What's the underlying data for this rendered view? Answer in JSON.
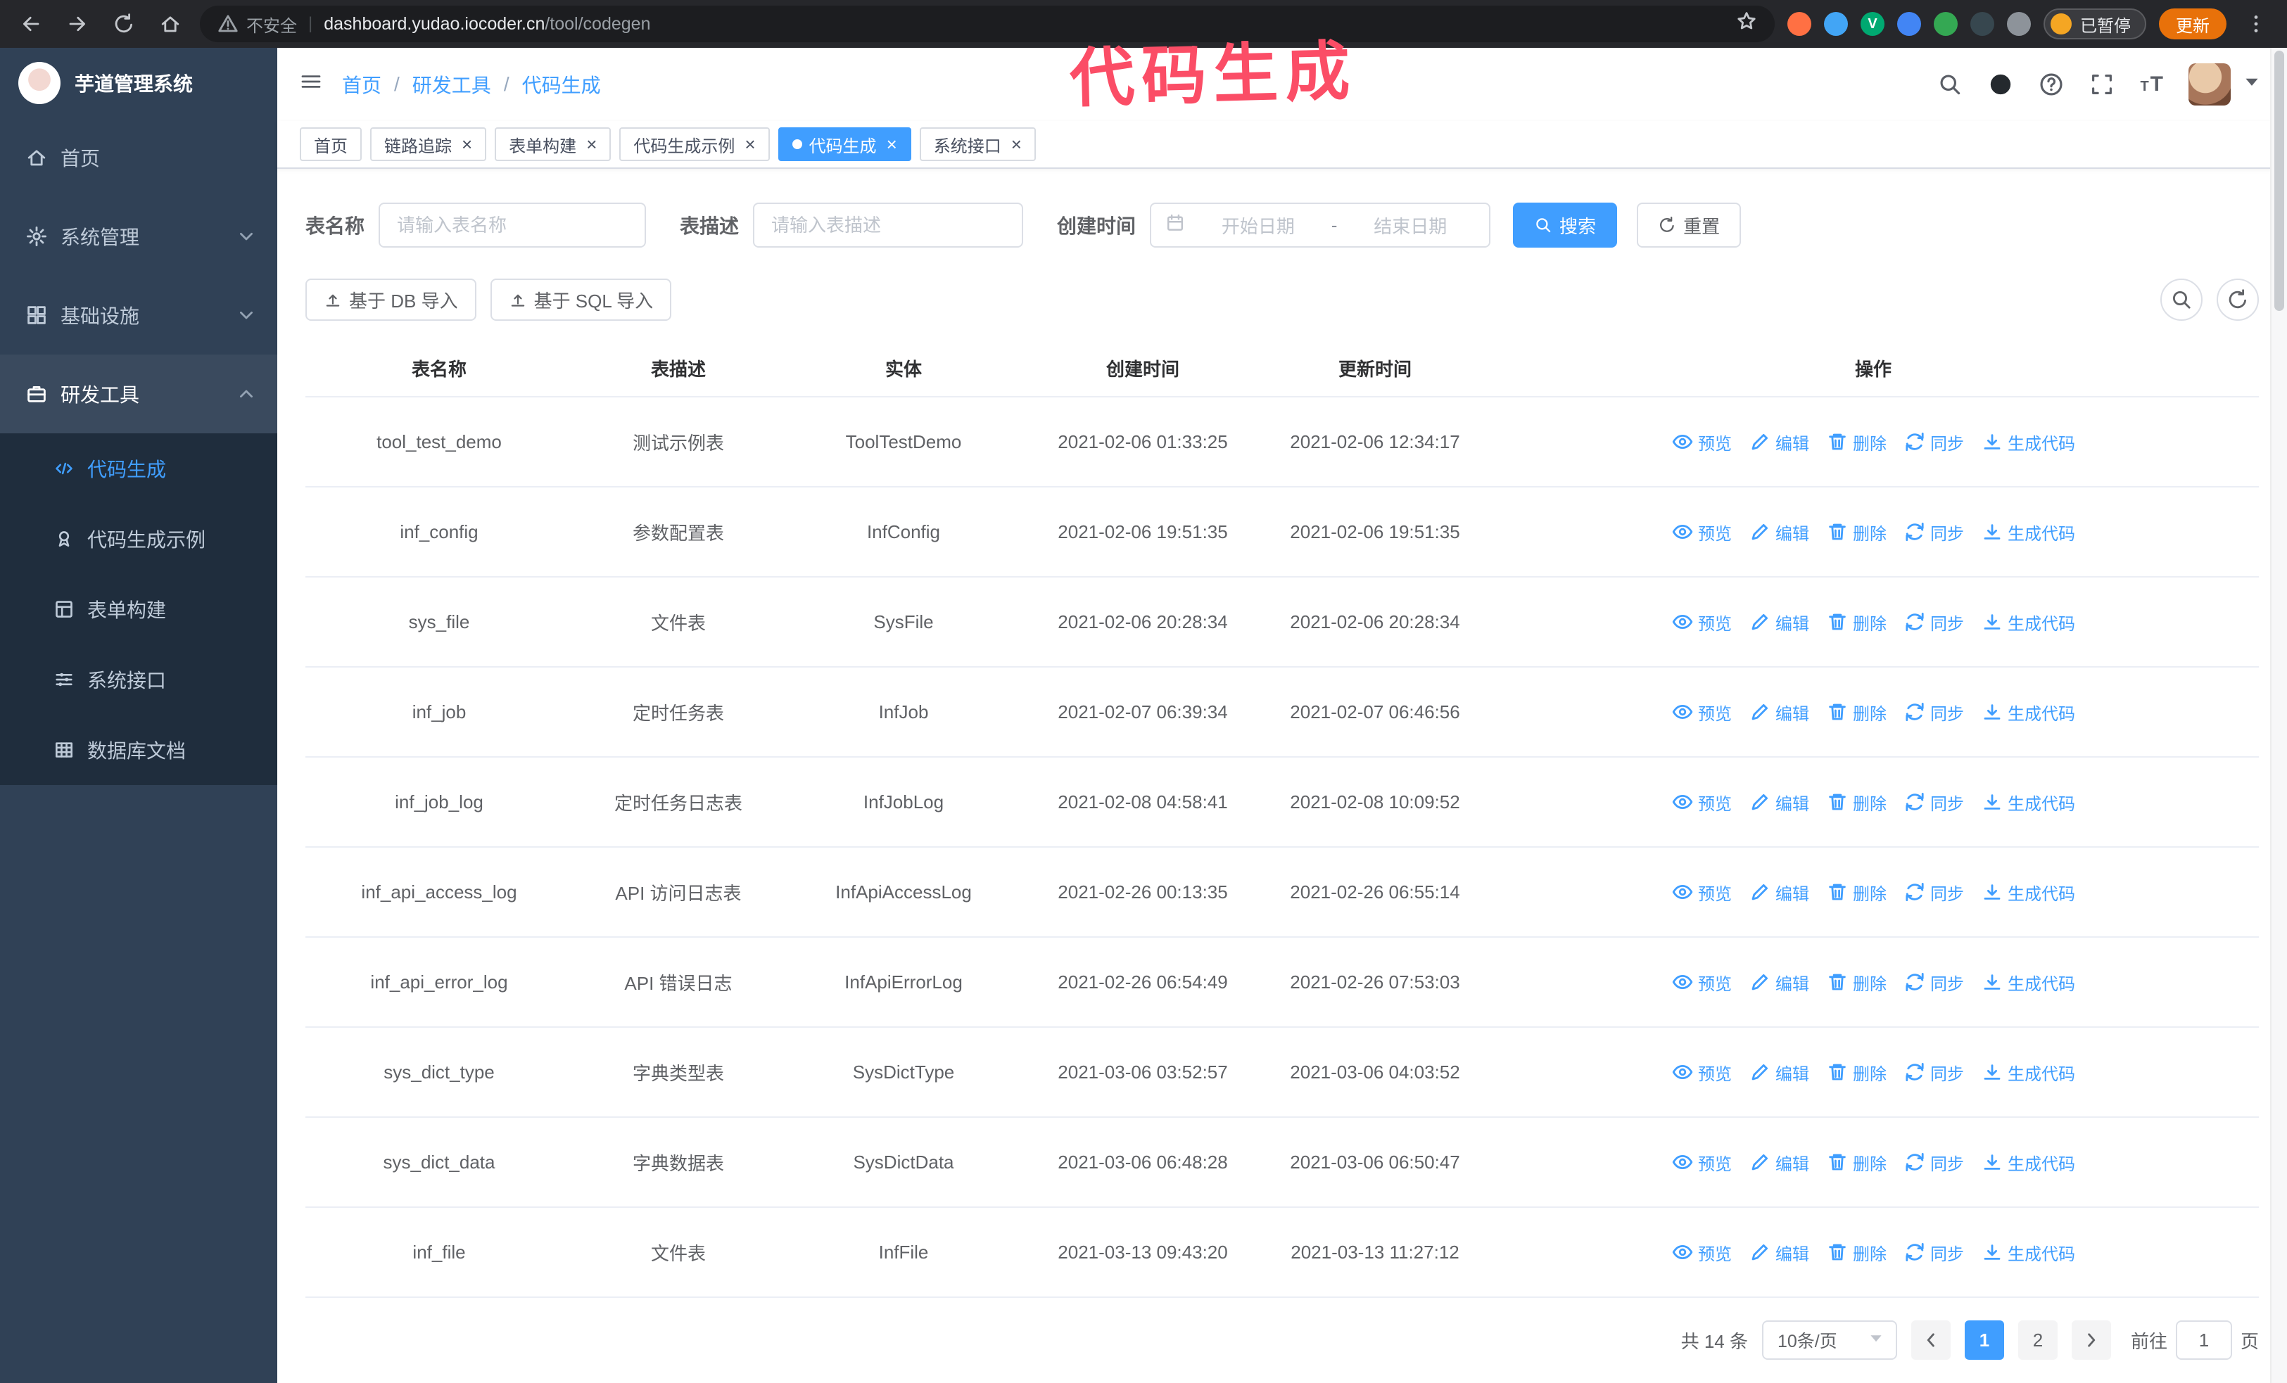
{
  "colors": {
    "accent": "#409eff",
    "sidebar": "#304156",
    "submenu": "#1f2d3d",
    "annotation": "#fb4d66",
    "update_button": "#e8710a"
  },
  "browser": {
    "security_label": "不安全",
    "url_host": "dashboard.yudao.iocoder.cn",
    "url_path": "/tool/codegen",
    "paused_badge": "已暂停",
    "update_button": "更新",
    "extensions": [
      {
        "color": "#ff7043"
      },
      {
        "color": "#42a5f5"
      },
      {
        "color": "#00a971",
        "letter": "V"
      },
      {
        "color": "#4285f4"
      },
      {
        "color": "#34a853"
      },
      {
        "color": "#37474f"
      },
      {
        "color": "#8d939a"
      }
    ]
  },
  "annotation": {
    "text": "代码生成"
  },
  "sidebar": {
    "logo_title": "芋道管理系统",
    "items": [
      {
        "id": "home",
        "label": "首页",
        "icon": "home-icon"
      },
      {
        "id": "system",
        "label": "系统管理",
        "icon": "gear-icon",
        "expandable": true
      },
      {
        "id": "infra",
        "label": "基础设施",
        "icon": "grid-icon",
        "expandable": true
      },
      {
        "id": "dev-tools",
        "label": "研发工具",
        "icon": "briefcase-icon",
        "expandable": true,
        "expanded": true
      }
    ],
    "submenu": [
      {
        "id": "codegen",
        "label": "代码生成",
        "icon": "code-icon",
        "active": true
      },
      {
        "id": "codegen-example",
        "label": "代码生成示例",
        "icon": "medal-icon"
      },
      {
        "id": "form-build",
        "label": "表单构建",
        "icon": "form-icon"
      },
      {
        "id": "api",
        "label": "系统接口",
        "icon": "api-icon"
      },
      {
        "id": "db-doc",
        "label": "数据库文档",
        "icon": "table-icon"
      }
    ]
  },
  "header": {
    "breadcrumb": [
      "首页",
      "研发工具",
      "代码生成"
    ]
  },
  "tabs": [
    {
      "id": "home",
      "label": "首页",
      "closable": false,
      "active": false
    },
    {
      "id": "trace",
      "label": "链路追踪",
      "closable": true,
      "active": false
    },
    {
      "id": "form-build",
      "label": "表单构建",
      "closable": true,
      "active": false
    },
    {
      "id": "codegen-example",
      "label": "代码生成示例",
      "closable": true,
      "active": false
    },
    {
      "id": "codegen",
      "label": "代码生成",
      "closable": true,
      "active": true
    },
    {
      "id": "api",
      "label": "系统接口",
      "closable": true,
      "active": false
    }
  ],
  "filters": {
    "name_label": "表名称",
    "name_placeholder": "请输入表名称",
    "desc_label": "表描述",
    "desc_placeholder": "请输入表描述",
    "time_label": "创建时间",
    "start_placeholder": "开始日期",
    "end_placeholder": "结束日期",
    "range_separator": "-",
    "search_button": "搜索",
    "reset_button": "重置"
  },
  "toolbar": {
    "import_db": "基于 DB 导入",
    "import_sql": "基于 SQL 导入"
  },
  "table": {
    "columns": [
      "表名称",
      "表描述",
      "实体",
      "创建时间",
      "更新时间",
      "操作"
    ],
    "actions": [
      {
        "label": "预览",
        "icon": "eye-icon"
      },
      {
        "label": "编辑",
        "icon": "edit-icon"
      },
      {
        "label": "删除",
        "icon": "trash-icon"
      },
      {
        "label": "同步",
        "icon": "sync-icon"
      },
      {
        "label": "生成代码",
        "icon": "download-icon"
      }
    ],
    "rows": [
      {
        "name": "tool_test_demo",
        "desc": "测试示例表",
        "entity": "ToolTestDemo",
        "created": "2021-02-06 01:33:25",
        "updated": "2021-02-06 12:34:17"
      },
      {
        "name": "inf_config",
        "desc": "参数配置表",
        "entity": "InfConfig",
        "created": "2021-02-06 19:51:35",
        "updated": "2021-02-06 19:51:35"
      },
      {
        "name": "sys_file",
        "desc": "文件表",
        "entity": "SysFile",
        "created": "2021-02-06 20:28:34",
        "updated": "2021-02-06 20:28:34"
      },
      {
        "name": "inf_job",
        "desc": "定时任务表",
        "entity": "InfJob",
        "created": "2021-02-07 06:39:34",
        "updated": "2021-02-07 06:46:56"
      },
      {
        "name": "inf_job_log",
        "desc": "定时任务日志表",
        "entity": "InfJobLog",
        "created": "2021-02-08 04:58:41",
        "updated": "2021-02-08 10:09:52"
      },
      {
        "name": "inf_api_access_log",
        "desc": "API 访问日志表",
        "entity": "InfApiAccessLog",
        "created": "2021-02-26 00:13:35",
        "updated": "2021-02-26 06:55:14"
      },
      {
        "name": "inf_api_error_log",
        "desc": "API 错误日志",
        "entity": "InfApiErrorLog",
        "created": "2021-02-26 06:54:49",
        "updated": "2021-02-26 07:53:03"
      },
      {
        "name": "sys_dict_type",
        "desc": "字典类型表",
        "entity": "SysDictType",
        "created": "2021-03-06 03:52:57",
        "updated": "2021-03-06 04:03:52"
      },
      {
        "name": "sys_dict_data",
        "desc": "字典数据表",
        "entity": "SysDictData",
        "created": "2021-03-06 06:48:28",
        "updated": "2021-03-06 06:50:47"
      },
      {
        "name": "inf_file",
        "desc": "文件表",
        "entity": "InfFile",
        "created": "2021-03-13 09:43:20",
        "updated": "2021-03-13 11:27:12"
      }
    ]
  },
  "pagination": {
    "total": "共 14 条",
    "page_size": "10条/页",
    "pages": [
      "1",
      "2"
    ],
    "active_page": "1",
    "goto_label": "前往",
    "goto_value": "1",
    "page_suffix": "页"
  }
}
